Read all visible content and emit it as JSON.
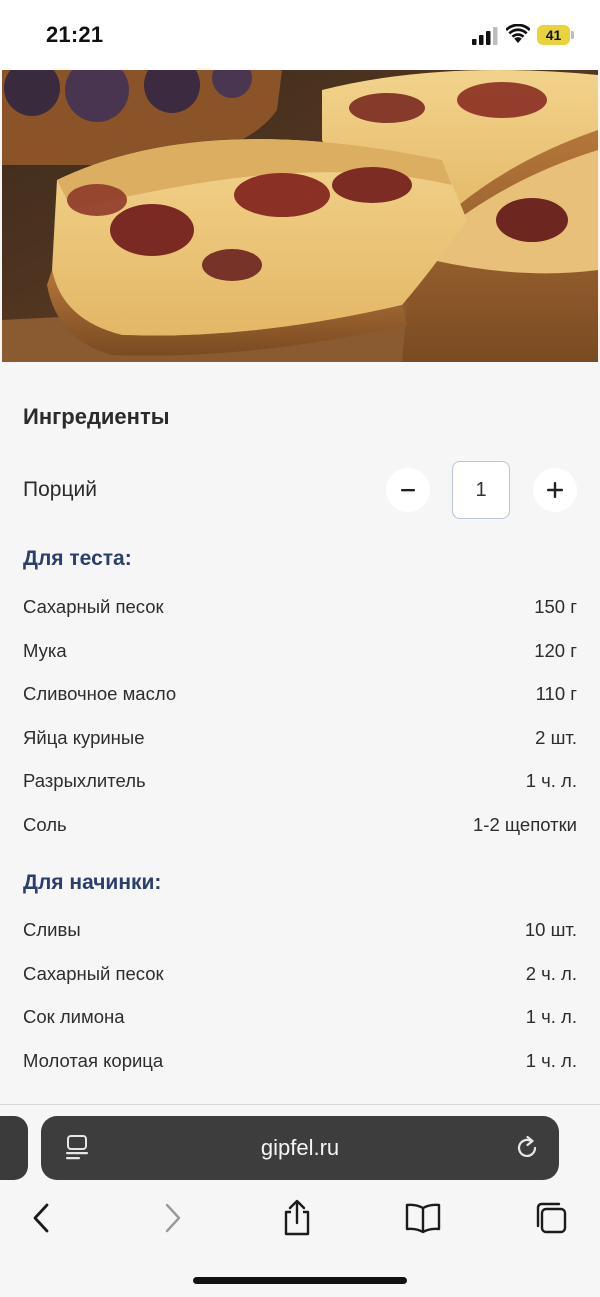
{
  "status_bar": {
    "time": "21:21",
    "battery": "41"
  },
  "ingredients": {
    "title": "Ингредиенты",
    "servings_label": "Порций",
    "servings_value": "1",
    "minus": "−",
    "plus": "+",
    "groups": [
      {
        "title": "Для теста:",
        "items": [
          {
            "name": "Сахарный песок",
            "amount": "150 г"
          },
          {
            "name": "Мука",
            "amount": "120 г"
          },
          {
            "name": "Сливочное масло",
            "amount": "110 г"
          },
          {
            "name": "Яйца куриные",
            "amount": "2 шт."
          },
          {
            "name": "Разрыхлитель",
            "amount": "1 ч. л."
          },
          {
            "name": "Соль",
            "amount": "1-2 щепотки"
          }
        ]
      },
      {
        "title": "Для начинки:",
        "items": [
          {
            "name": "Сливы",
            "amount": "10 шт."
          },
          {
            "name": "Сахарный песок",
            "amount": "2 ч. л."
          },
          {
            "name": "Сок лимона",
            "amount": "1 ч. л."
          },
          {
            "name": "Молотая корица",
            "amount": "1 ч. л."
          }
        ]
      }
    ]
  },
  "browser": {
    "address": "gipfel.ru",
    "icons": [
      "page-menu-icon",
      "reload-icon",
      "back-icon",
      "forward-icon",
      "share-icon",
      "bookmarks-icon",
      "tabs-icon"
    ]
  },
  "colors": {
    "group_title": "#2c3e6b",
    "battery": "#e8d33d",
    "address_bar": "#3d3d3d"
  }
}
